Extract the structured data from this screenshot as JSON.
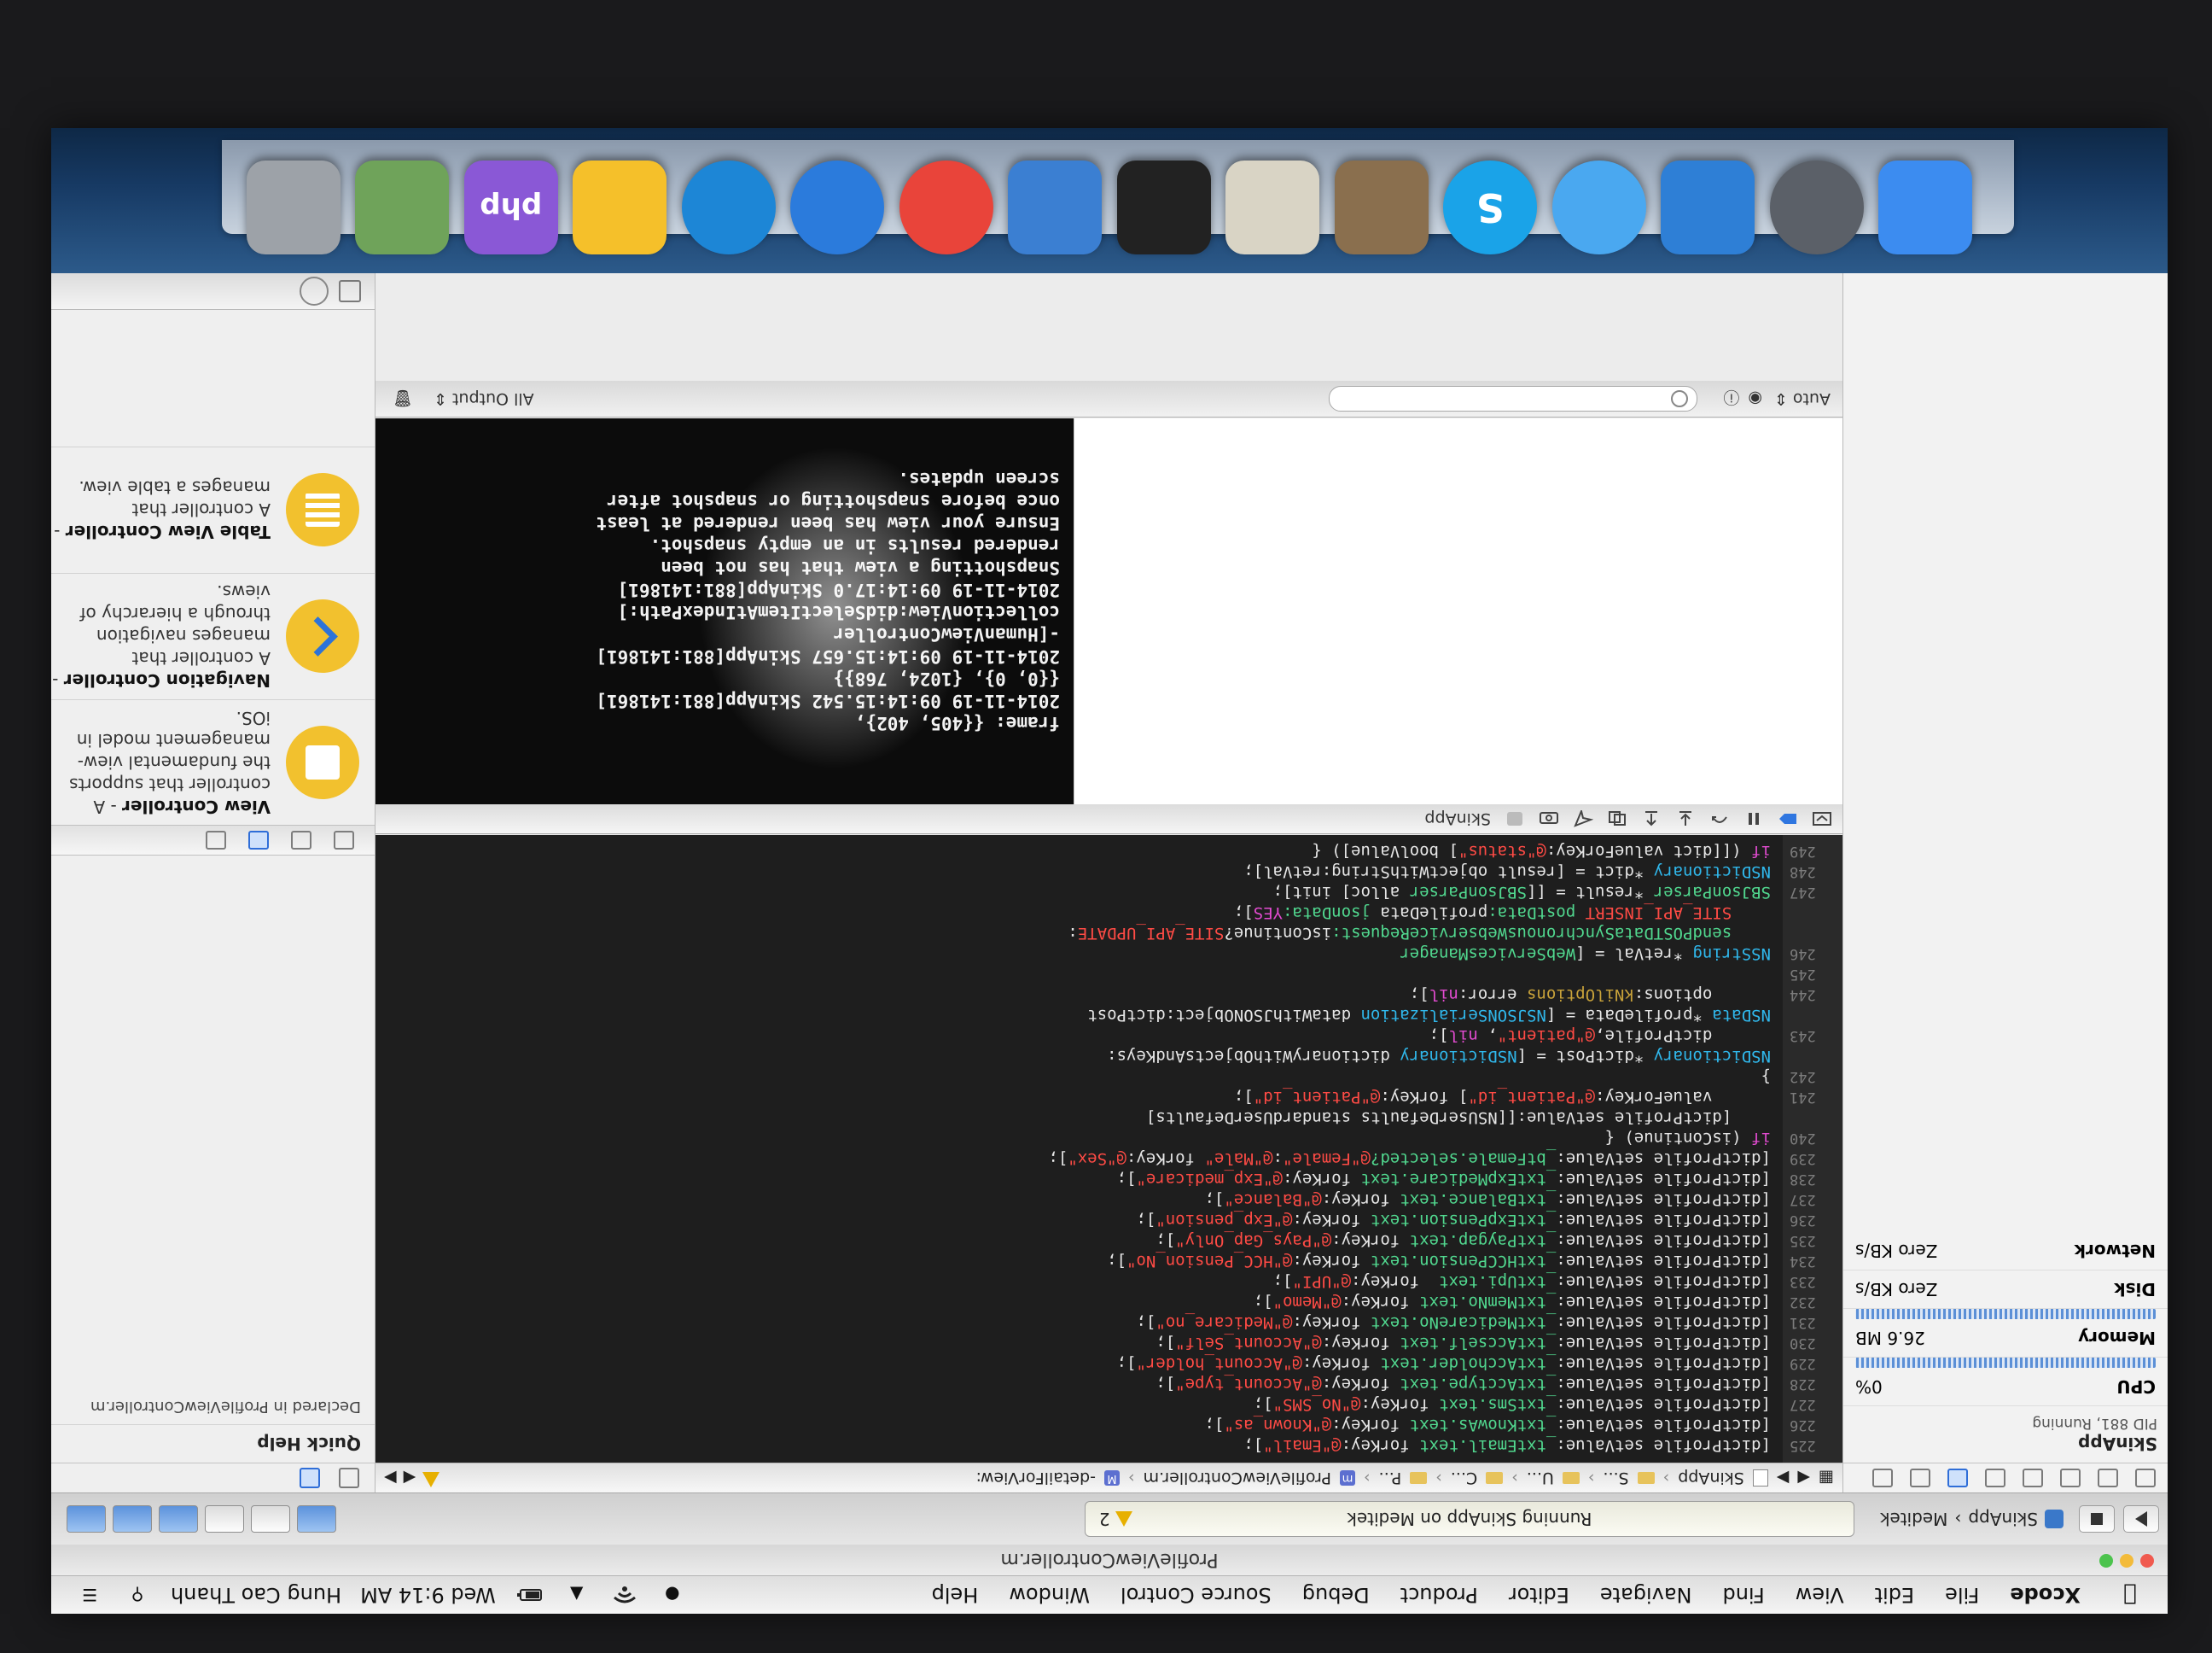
{
  "menubar": {
    "app_name": "Xcode",
    "items": [
      "File",
      "Edit",
      "View",
      "Find",
      "Navigate",
      "Editor",
      "Product",
      "Debug",
      "Source Control",
      "Window",
      "Help"
    ],
    "clock": "Wed 9:14 AM",
    "user": "Hung Cao Thanh"
  },
  "window": {
    "title": "ProfileViewController.m"
  },
  "toolbar": {
    "scheme": "SkinApp",
    "destination": "Meditek",
    "activity_status": "Running SkinApp on Meditek",
    "warning_count": "2"
  },
  "jumpbar": {
    "crumbs": [
      "SkinApp",
      "S...",
      "U...",
      "C...",
      "P...",
      "ProfileViewController.m",
      "-detailForView:"
    ]
  },
  "navigator": {
    "process_name": "SkinApp",
    "process_pid": "PID 881, Running",
    "cpu_label": "CPU",
    "cpu_value": "0%",
    "memory_label": "Memory",
    "memory_value": "26.6 MB",
    "disk_label": "Disk",
    "disk_value": "Zero KB/s",
    "network_label": "Network",
    "network_value": "Zero KB/s"
  },
  "editor": {
    "line_numbers": [
      "225",
      "226",
      "227",
      "228",
      "229",
      "230",
      "231",
      "232",
      "233",
      "234",
      "235",
      "236",
      "237",
      "238",
      "239",
      "240",
      "",
      "241",
      "242",
      "",
      "243",
      "",
      "244",
      "245",
      "246",
      "",
      "",
      "247",
      "248",
      "249"
    ],
    "lines": [
      [
        [
          "t-plain",
          "[dictProfile setValue:"
        ],
        [
          "t-sel",
          "_txtEmail.text"
        ],
        [
          "t-plain",
          " forKey:"
        ],
        [
          "t-str",
          "@\"Email\""
        ],
        [
          "t-plain",
          "];"
        ]
      ],
      [
        [
          "t-plain",
          "[dictProfile setValue:"
        ],
        [
          "t-sel",
          "_txtKnowAs.text"
        ],
        [
          "t-plain",
          " forKey:"
        ],
        [
          "t-str",
          "@\"Known_as\""
        ],
        [
          "t-plain",
          "];"
        ]
      ],
      [
        [
          "t-plain",
          "[dictProfile setValue:"
        ],
        [
          "t-sel",
          "_txtSms.text"
        ],
        [
          "t-plain",
          " forKey:"
        ],
        [
          "t-str",
          "@\"No_SMS\""
        ],
        [
          "t-plain",
          "];"
        ]
      ],
      [
        [
          "t-plain",
          "[dictProfile setValue:"
        ],
        [
          "t-sel",
          "_txtAcctype.text"
        ],
        [
          "t-plain",
          " forKey:"
        ],
        [
          "t-str",
          "@\"Account_type\""
        ],
        [
          "t-plain",
          "];"
        ]
      ],
      [
        [
          "t-plain",
          "[dictProfile setValue:"
        ],
        [
          "t-sel",
          "_txtAccholder.text"
        ],
        [
          "t-plain",
          " forKey:"
        ],
        [
          "t-str",
          "@\"Account_holder\""
        ],
        [
          "t-plain",
          "];"
        ]
      ],
      [
        [
          "t-plain",
          "[dictProfile setValue:"
        ],
        [
          "t-sel",
          "_txtAccself.text"
        ],
        [
          "t-plain",
          " forKey:"
        ],
        [
          "t-str",
          "@\"Account_Self\""
        ],
        [
          "t-plain",
          "];"
        ]
      ],
      [
        [
          "t-plain",
          "[dictProfile setValue:"
        ],
        [
          "t-sel",
          "_txtMedicareNo.text"
        ],
        [
          "t-plain",
          " forKey:"
        ],
        [
          "t-str",
          "@\"Medicare_no\""
        ],
        [
          "t-plain",
          "];"
        ]
      ],
      [
        [
          "t-plain",
          "[dictProfile setValue:"
        ],
        [
          "t-sel",
          "_txtMemNo.text"
        ],
        [
          "t-plain",
          " forKey:"
        ],
        [
          "t-str",
          "@\"Memo\""
        ],
        [
          "t-plain",
          "];"
        ]
      ],
      [
        [
          "t-plain",
          "[dictProfile setValue:"
        ],
        [
          "t-sel",
          "_txtUpi.text"
        ],
        [
          "t-plain",
          "  forKey:"
        ],
        [
          "t-str",
          "@\"UPI\""
        ],
        [
          "t-plain",
          "];"
        ]
      ],
      [
        [
          "t-plain",
          "[dictProfile setValue:"
        ],
        [
          "t-sel",
          "_txtHCCPension.text"
        ],
        [
          "t-plain",
          " forKey:"
        ],
        [
          "t-str",
          "@\"HCC_Pension_No\""
        ],
        [
          "t-plain",
          "];"
        ]
      ],
      [
        [
          "t-plain",
          "[dictProfile setValue:"
        ],
        [
          "t-sel",
          "_txtPaygap.text"
        ],
        [
          "t-plain",
          " forKey:"
        ],
        [
          "t-str",
          "@\"Pays_Gap_Only\""
        ],
        [
          "t-plain",
          "];"
        ]
      ],
      [
        [
          "t-plain",
          "[dictProfile setValue:"
        ],
        [
          "t-sel",
          "_txtExpPension.text"
        ],
        [
          "t-plain",
          " forKey:"
        ],
        [
          "t-str",
          "@\"Exp_pension\""
        ],
        [
          "t-plain",
          "];"
        ]
      ],
      [
        [
          "t-plain",
          "[dictProfile setValue:"
        ],
        [
          "t-sel",
          "_txtBalance.text"
        ],
        [
          "t-plain",
          " forKey:"
        ],
        [
          "t-str",
          "@\"Balance\""
        ],
        [
          "t-plain",
          "];"
        ]
      ],
      [
        [
          "t-plain",
          "[dictProfile setValue:"
        ],
        [
          "t-sel",
          "_txtExpMedicare.text"
        ],
        [
          "t-plain",
          " forKey:"
        ],
        [
          "t-str",
          "@\"Exp_medicare\""
        ],
        [
          "t-plain",
          "];"
        ]
      ],
      [
        [
          "t-plain",
          "[dictProfile setValue:"
        ],
        [
          "t-sel",
          "_btFemale.selected?"
        ],
        [
          "t-str",
          "@\"Female\""
        ],
        [
          "t-plain",
          ":"
        ],
        [
          "t-str",
          "@\"Male\""
        ],
        [
          "t-plain",
          " forKey:"
        ],
        [
          "t-str",
          "@\"Sex\""
        ],
        [
          "t-plain",
          "];"
        ]
      ],
      [
        [
          "t-kw",
          "if"
        ],
        [
          "t-plain",
          " (isContinue) {"
        ]
      ],
      [
        [
          "t-plain",
          "    [dictProfile setValue:[[NSUserDefaults standardUserDefaults]"
        ]
      ],
      [
        [
          "t-plain",
          "      valueForKey:"
        ],
        [
          "t-str",
          "@\"Patient_id\""
        ],
        [
          "t-plain",
          "] forKey:"
        ],
        [
          "t-str",
          "@\"Patient_id\""
        ],
        [
          "t-plain",
          "];"
        ]
      ],
      [
        [
          "t-plain",
          "}"
        ]
      ],
      [
        [
          "t-type",
          "NSDictionary"
        ],
        [
          "t-plain",
          " *dictPost = ["
        ],
        [
          "t-type",
          "NSDictionary"
        ],
        [
          "t-plain",
          " dictionaryWithObjectsAndKeys:"
        ]
      ],
      [
        [
          "t-plain",
          "      dictProfile,"
        ],
        [
          "t-str",
          "@\"patient\""
        ],
        [
          "t-plain",
          ", "
        ],
        [
          "t-kw",
          "nil"
        ],
        [
          "t-plain",
          "];"
        ]
      ],
      [
        [
          "t-type",
          "NSData"
        ],
        [
          "t-plain",
          " *profileData = ["
        ],
        [
          "t-type",
          "NSJSONSerialization"
        ],
        [
          "t-plain",
          " dataWithJSONObject:dictPost"
        ]
      ],
      [
        [
          "t-plain",
          "      options:"
        ],
        [
          "t-const",
          "kNilOptions"
        ],
        [
          "t-plain",
          " error:"
        ],
        [
          "t-kw",
          "nil"
        ],
        [
          "t-plain",
          "];"
        ]
      ],
      [
        [
          "t-plain",
          ""
        ]
      ],
      [
        [
          "t-type",
          "NSString"
        ],
        [
          "t-plain",
          " *retVal = ["
        ],
        [
          "t-sel",
          "WebServicesManager"
        ]
      ],
      [
        [
          "t-sel",
          "    sendPOSTDataSynchronousWebserviceRequest:"
        ],
        [
          "t-plain",
          "isContinue?"
        ],
        [
          "t-str",
          "SITE_API_UPDATE"
        ],
        [
          "t-plain",
          ":"
        ]
      ],
      [
        [
          "t-str",
          "    SITE_API_INSERT"
        ],
        [
          "t-sel",
          " postData:"
        ],
        [
          "t-plain",
          "profileData "
        ],
        [
          "t-sel",
          "jsonData:"
        ],
        [
          "t-kw",
          "YES"
        ],
        [
          "t-plain",
          "];"
        ]
      ],
      [
        [
          "t-sel",
          "SBJsonParser"
        ],
        [
          "t-plain",
          " *result = [["
        ],
        [
          "t-sel",
          "SBJsonParser"
        ],
        [
          "t-plain",
          " alloc] init];"
        ]
      ],
      [
        [
          "t-type",
          "NSDictionary"
        ],
        [
          "t-plain",
          " *dict = [result objectWithString:retVal];"
        ]
      ],
      [
        [
          "t-kw",
          "if"
        ],
        [
          "t-plain",
          " ([[dict valueForKey:"
        ],
        [
          "t-str",
          "@\"status\""
        ],
        [
          "t-plain",
          "] boolValue]) {"
        ]
      ]
    ]
  },
  "debugbar": {
    "target": "SkinApp"
  },
  "console": {
    "lines": [
      "frame: {{405, 402},",
      "2014-11-19 09:14:15.542 SkinApp[881:141861]",
      "{{0, 0}, {1024, 768}}",
      "2014-11-19 09:14:15.657 SkinApp[881:141861]",
      "-[HumanViewController",
      "collectionView:didSelectItemAtIndexPath:]",
      "2014-11-19 09:14:17.0 SkinApp[881:141861]",
      "Snapshotting a view that has not been",
      "rendered results in an empty snapshot.",
      "Ensure your view has been rendered at least",
      "once before snapshotting or snapshot after",
      "screen updates."
    ],
    "scope": "Auto",
    "output_filter": "All Output"
  },
  "utilities": {
    "quick_help_title": "Quick Help",
    "quick_help_text": "Declared in ProfileViewController.m",
    "library": [
      {
        "title": "View Controller",
        "desc": "- A controller that supports the fundamental view-management model in iOS."
      },
      {
        "title": "Navigation Controller",
        "desc": "- A controller that manages navigation through a hierarchy of views."
      },
      {
        "title": "Table View Controller",
        "desc": "- A controller that manages a table view."
      }
    ]
  },
  "dock": {
    "apps": [
      {
        "name": "Finder",
        "color": "#3c8cf0"
      },
      {
        "name": "Launchpad",
        "color": "#5b6068"
      },
      {
        "name": "Xcode",
        "color": "#2e7fd6"
      },
      {
        "name": "Safari",
        "color": "#4aa8f0"
      },
      {
        "name": "Skype",
        "color": "#1aa3e8"
      },
      {
        "name": "iPhoto",
        "color": "#8a6f4e"
      },
      {
        "name": "TextEdit",
        "color": "#d9d4c5"
      },
      {
        "name": "Terminal",
        "color": "#222222"
      },
      {
        "name": "Simulator",
        "color": "#3b7fd2"
      },
      {
        "name": "Chrome",
        "color": "#e9443a"
      },
      {
        "name": "Shazam",
        "color": "#2b7bdc"
      },
      {
        "name": "TeamViewer",
        "color": "#1d86d6"
      },
      {
        "name": "Cyberduck",
        "color": "#f5c02a"
      },
      {
        "name": "PhpStorm",
        "color": "#8a58d6"
      },
      {
        "name": "Preview",
        "color": "#6fa35a"
      },
      {
        "name": "Trash",
        "color": "#9da2a8"
      }
    ],
    "php_label": "php"
  }
}
